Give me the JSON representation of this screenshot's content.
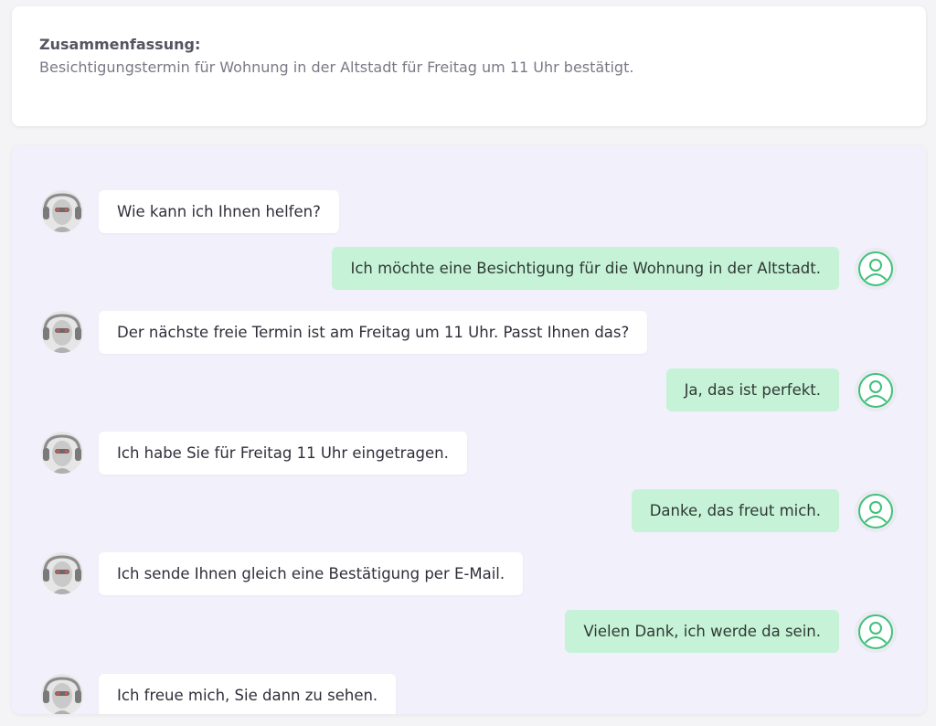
{
  "summary": {
    "title": "Zusammenfassung:",
    "text": "Besichtigungstermin für Wohnung in der Altstadt für Freitag um 11 Uhr bestätigt."
  },
  "colors": {
    "bot_bubble": "#ffffff",
    "user_bubble": "#c6f2d8",
    "user_icon": "#3fc07a",
    "panel_bg": "#f1f0fb"
  },
  "messages": [
    {
      "sender": "bot",
      "text": "Wie kann ich Ihnen helfen?"
    },
    {
      "sender": "user",
      "text": "Ich möchte eine Besichtigung für die Wohnung in der Altstadt."
    },
    {
      "sender": "bot",
      "text": "Der nächste freie Termin ist am Freitag um 11 Uhr. Passt Ihnen das?"
    },
    {
      "sender": "user",
      "text": "Ja, das ist perfekt."
    },
    {
      "sender": "bot",
      "text": "Ich habe Sie für Freitag 11 Uhr eingetragen."
    },
    {
      "sender": "user",
      "text": "Danke, das freut mich."
    },
    {
      "sender": "bot",
      "text": "Ich sende Ihnen gleich eine Bestätigung per E-Mail."
    },
    {
      "sender": "user",
      "text": "Vielen Dank, ich werde da sein."
    },
    {
      "sender": "bot",
      "text": "Ich freue mich, Sie dann zu sehen."
    }
  ]
}
